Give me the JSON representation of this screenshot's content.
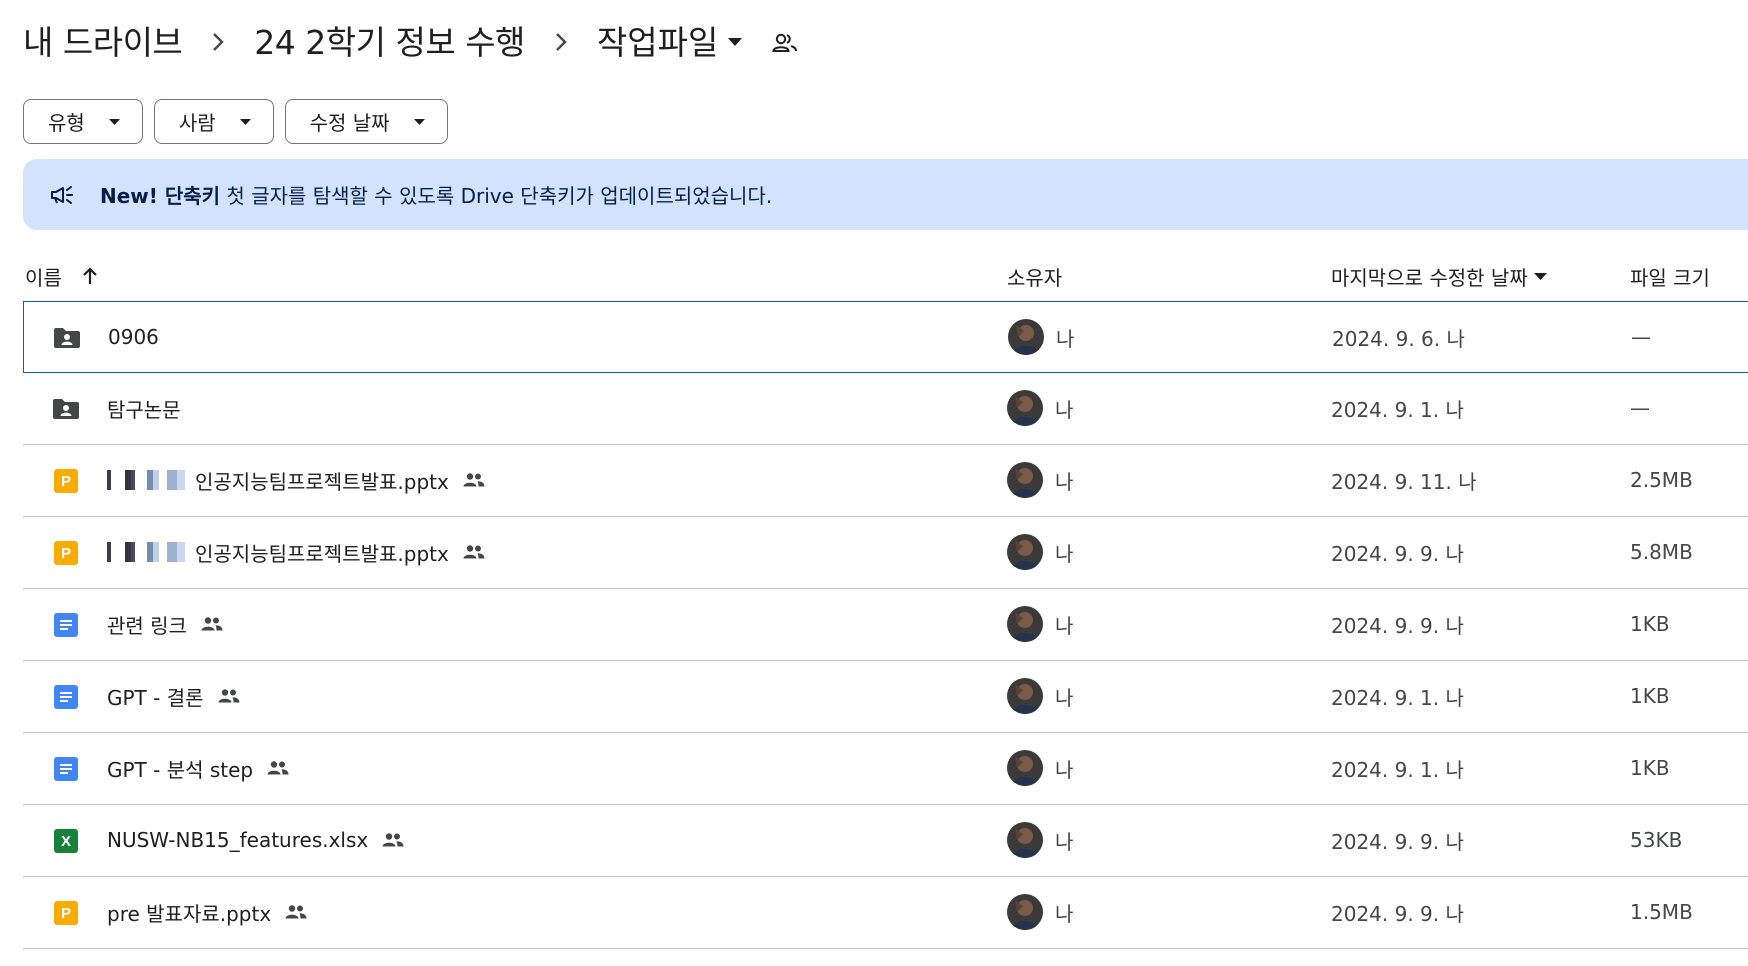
{
  "breadcrumb": {
    "items": [
      "내 드라이브",
      "24 2학기 정보 수행"
    ],
    "current": "작업파일"
  },
  "filters": [
    "유형",
    "사람",
    "수정 날짜"
  ],
  "banner": {
    "bold": "New! 단축키",
    "text": " 첫 글자를 탐색할 수 있도록 Drive 단축키가 업데이트되었습니다."
  },
  "columns": {
    "name": "이름",
    "owner": "소유자",
    "modified": "마지막으로 수정한 날짜",
    "size": "파일 크기"
  },
  "files": [
    {
      "type": "shared-folder",
      "name": "0906",
      "owner": "나",
      "modified": "2024. 9. 6. 나",
      "size": "—",
      "shared": false
    },
    {
      "type": "shared-folder",
      "name": "탐구논문",
      "owner": "나",
      "modified": "2024. 9. 1. 나",
      "size": "—",
      "shared": false
    },
    {
      "type": "slides",
      "name": "인공지능팀프로젝트발표.pptx",
      "owner": "나",
      "modified": "2024. 9. 11. 나",
      "size": "2.5MB",
      "shared": true
    },
    {
      "type": "slides",
      "name": "인공지능팀프로젝트발표.pptx",
      "owner": "나",
      "modified": "2024. 9. 9. 나",
      "size": "5.8MB",
      "shared": true
    },
    {
      "type": "doc",
      "name": "관련 링크",
      "owner": "나",
      "modified": "2024. 9. 9. 나",
      "size": "1KB",
      "shared": true
    },
    {
      "type": "doc",
      "name": "GPT - 결론",
      "owner": "나",
      "modified": "2024. 9. 1. 나",
      "size": "1KB",
      "shared": true
    },
    {
      "type": "doc",
      "name": "GPT - 분석 step",
      "owner": "나",
      "modified": "2024. 9. 1. 나",
      "size": "1KB",
      "shared": true
    },
    {
      "type": "sheet",
      "name": "NUSW-NB15_features.xlsx",
      "owner": "나",
      "modified": "2024. 9. 9. 나",
      "size": "53KB",
      "shared": true
    },
    {
      "type": "slides",
      "name": "pre 발표자료.pptx",
      "owner": "나",
      "modified": "2024. 9. 9. 나",
      "size": "1.5MB",
      "shared": true
    }
  ],
  "colors": {
    "banner_bg": "#d3e3fd",
    "selected_border": "#0b57d0",
    "slides": "#f9ab00",
    "doc": "#4285f4",
    "sheet": "#188038"
  }
}
